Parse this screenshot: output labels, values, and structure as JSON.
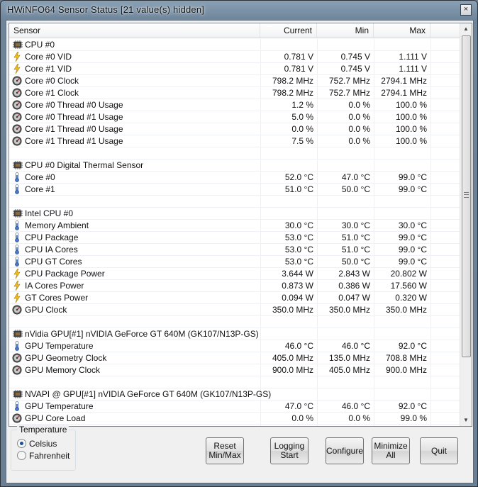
{
  "window": {
    "title": "HWiNFO64 Sensor Status [21 value(s) hidden]",
    "close_glyph": "×"
  },
  "columns": {
    "sensor": "Sensor",
    "current": "Current",
    "min": "Min",
    "max": "Max"
  },
  "rows": [
    {
      "type": "group",
      "icon": "chip-icon",
      "name": "CPU #0"
    },
    {
      "type": "value",
      "icon": "voltage-icon",
      "name": "Core #0 VID",
      "current": "0.781 V",
      "min": "0.745 V",
      "max": "1.111 V"
    },
    {
      "type": "value",
      "icon": "voltage-icon",
      "name": "Core #1 VID",
      "current": "0.781 V",
      "min": "0.745 V",
      "max": "1.111 V"
    },
    {
      "type": "value",
      "icon": "gauge-icon",
      "name": "Core #0 Clock",
      "current": "798.2 MHz",
      "min": "752.7 MHz",
      "max": "2794.1 MHz"
    },
    {
      "type": "value",
      "icon": "gauge-icon",
      "name": "Core #1 Clock",
      "current": "798.2 MHz",
      "min": "752.7 MHz",
      "max": "2794.1 MHz"
    },
    {
      "type": "value",
      "icon": "gauge-icon",
      "name": "Core #0 Thread #0 Usage",
      "current": "1.2 %",
      "min": "0.0 %",
      "max": "100.0 %"
    },
    {
      "type": "value",
      "icon": "gauge-icon",
      "name": "Core #0 Thread #1 Usage",
      "current": "5.0 %",
      "min": "0.0 %",
      "max": "100.0 %"
    },
    {
      "type": "value",
      "icon": "gauge-icon",
      "name": "Core #1 Thread #0 Usage",
      "current": "0.0 %",
      "min": "0.0 %",
      "max": "100.0 %"
    },
    {
      "type": "value",
      "icon": "gauge-icon",
      "name": "Core #1 Thread #1 Usage",
      "current": "7.5 %",
      "min": "0.0 %",
      "max": "100.0 %"
    },
    {
      "type": "blank"
    },
    {
      "type": "group",
      "icon": "chip-icon",
      "name": "CPU #0 Digital Thermal Sensor"
    },
    {
      "type": "value",
      "icon": "thermometer-icon",
      "name": "Core #0",
      "current": "52.0 °C",
      "min": "47.0 °C",
      "max": "99.0 °C"
    },
    {
      "type": "value",
      "icon": "thermometer-icon",
      "name": "Core #1",
      "current": "51.0 °C",
      "min": "50.0 °C",
      "max": "99.0 °C"
    },
    {
      "type": "blank"
    },
    {
      "type": "group",
      "icon": "chip-icon",
      "name": "Intel CPU #0"
    },
    {
      "type": "value",
      "icon": "thermometer-icon",
      "name": "Memory Ambient",
      "current": "30.0 °C",
      "min": "30.0 °C",
      "max": "30.0 °C"
    },
    {
      "type": "value",
      "icon": "thermometer-icon",
      "name": "CPU Package",
      "current": "53.0 °C",
      "min": "51.0 °C",
      "max": "99.0 °C"
    },
    {
      "type": "value",
      "icon": "thermometer-icon",
      "name": "CPU IA Cores",
      "current": "53.0 °C",
      "min": "51.0 °C",
      "max": "99.0 °C"
    },
    {
      "type": "value",
      "icon": "thermometer-icon",
      "name": "CPU GT Cores",
      "current": "53.0 °C",
      "min": "50.0 °C",
      "max": "99.0 °C"
    },
    {
      "type": "value",
      "icon": "voltage-icon",
      "name": "CPU Package Power",
      "current": "3.644 W",
      "min": "2.843 W",
      "max": "20.802 W"
    },
    {
      "type": "value",
      "icon": "voltage-icon",
      "name": "IA Cores Power",
      "current": "0.873 W",
      "min": "0.386 W",
      "max": "17.560 W"
    },
    {
      "type": "value",
      "icon": "voltage-icon",
      "name": "GT Cores Power",
      "current": "0.094 W",
      "min": "0.047 W",
      "max": "0.320 W"
    },
    {
      "type": "value",
      "icon": "gauge-icon",
      "name": "GPU Clock",
      "current": "350.0 MHz",
      "min": "350.0 MHz",
      "max": "350.0 MHz"
    },
    {
      "type": "blank"
    },
    {
      "type": "group",
      "icon": "chip-icon",
      "name": "nVidia GPU[#1] nVIDIA GeForce GT 640M (GK107/N13P-GS)"
    },
    {
      "type": "value",
      "icon": "thermometer-icon",
      "name": "GPU Temperature",
      "current": "46.0 °C",
      "min": "46.0 °C",
      "max": "92.0 °C"
    },
    {
      "type": "value",
      "icon": "gauge-icon",
      "name": "GPU Geometry Clock",
      "current": "405.0 MHz",
      "min": "135.0 MHz",
      "max": "708.8 MHz"
    },
    {
      "type": "value",
      "icon": "gauge-icon",
      "name": "GPU Memory Clock",
      "current": "900.0 MHz",
      "min": "405.0 MHz",
      "max": "900.0 MHz"
    },
    {
      "type": "blank"
    },
    {
      "type": "group",
      "icon": "chip-icon",
      "name": "NVAPI @ GPU[#1] nVIDIA GeForce GT 640M (GK107/N13P-GS)"
    },
    {
      "type": "value",
      "icon": "thermometer-icon",
      "name": "GPU Temperature",
      "current": "47.0 °C",
      "min": "46.0 °C",
      "max": "92.0 °C"
    },
    {
      "type": "value",
      "icon": "gauge-icon",
      "name": "GPU Core Load",
      "current": "0.0 %",
      "min": "0.0 %",
      "max": "99.0 %"
    }
  ],
  "temperature": {
    "title": "Temperature",
    "options": [
      "Celsius",
      "Fahrenheit"
    ],
    "selected": "Celsius"
  },
  "buttons": {
    "reset": "Reset\nMin/Max",
    "logging": "Logging\nStart",
    "configure": "Configure",
    "minimize": "Minimize\nAll",
    "quit": "Quit"
  },
  "colors": {
    "voltage": "#f2c020",
    "thermometer": "#4a78c8",
    "gauge": "#555555",
    "chip": "#4a4a4a"
  }
}
